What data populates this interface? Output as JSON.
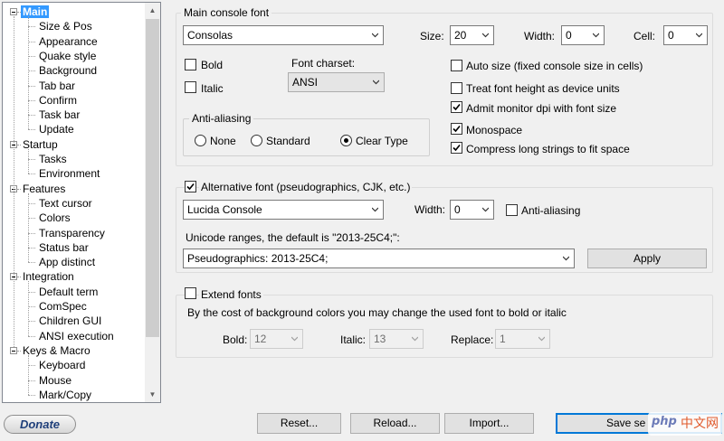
{
  "tree": {
    "items": [
      {
        "label": "Main",
        "level": 0,
        "expanded": true,
        "selected": true
      },
      {
        "label": "Size & Pos",
        "level": 1
      },
      {
        "label": "Appearance",
        "level": 1
      },
      {
        "label": "Quake style",
        "level": 1
      },
      {
        "label": "Background",
        "level": 1
      },
      {
        "label": "Tab bar",
        "level": 1
      },
      {
        "label": "Confirm",
        "level": 1
      },
      {
        "label": "Task bar",
        "level": 1
      },
      {
        "label": "Update",
        "level": 1
      },
      {
        "label": "Startup",
        "level": 0,
        "expanded": true
      },
      {
        "label": "Tasks",
        "level": 1
      },
      {
        "label": "Environment",
        "level": 1
      },
      {
        "label": "Features",
        "level": 0,
        "expanded": true
      },
      {
        "label": "Text cursor",
        "level": 1
      },
      {
        "label": "Colors",
        "level": 1
      },
      {
        "label": "Transparency",
        "level": 1
      },
      {
        "label": "Status bar",
        "level": 1
      },
      {
        "label": "App distinct",
        "level": 1
      },
      {
        "label": "Integration",
        "level": 0,
        "expanded": true
      },
      {
        "label": "Default term",
        "level": 1
      },
      {
        "label": "ComSpec",
        "level": 1
      },
      {
        "label": "Children GUI",
        "level": 1
      },
      {
        "label": "ANSI execution",
        "level": 1
      },
      {
        "label": "Keys & Macro",
        "level": 0,
        "expanded": true
      },
      {
        "label": "Keyboard",
        "level": 1
      },
      {
        "label": "Mouse",
        "level": 1
      },
      {
        "label": "Mark/Copy",
        "level": 1
      }
    ]
  },
  "main_font": {
    "title": "Main console font",
    "font_name": "Consolas",
    "size_label": "Size:",
    "size_value": "20",
    "width_label": "Width:",
    "width_value": "0",
    "cell_label": "Cell:",
    "cell_value": "0",
    "bold_label": "Bold",
    "bold_checked": false,
    "italic_label": "Italic",
    "italic_checked": false,
    "charset_label": "Font charset:",
    "charset_value": "ANSI",
    "antialias_title": "Anti-aliasing",
    "aa_none": "None",
    "aa_standard": "Standard",
    "aa_cleartype": "Clear Type",
    "aa_selected": "cleartype",
    "autosize_label": "Auto size (fixed console size in cells)",
    "autosize_checked": false,
    "treat_height_label": "Treat font height as device units",
    "treat_height_checked": false,
    "admit_dpi_label": "Admit monitor dpi with font size",
    "admit_dpi_checked": true,
    "monospace_label": "Monospace",
    "monospace_checked": true,
    "compress_label": "Compress long strings to fit space",
    "compress_checked": true
  },
  "alt_font": {
    "checkbox_label": "Alternative font (pseudographics, CJK, etc.)",
    "checked": true,
    "font_name": "Lucida Console",
    "width_label": "Width:",
    "width_value": "0",
    "antialias_label": "Anti-aliasing",
    "antialias_checked": false,
    "ranges_label": "Unicode ranges, the default is \"2013-25C4;\":",
    "ranges_value": "Pseudographics: 2013-25C4;",
    "apply_label": "Apply"
  },
  "extend_fonts": {
    "checkbox_label": "Extend fonts",
    "checked": false,
    "description": "By the cost of background colors you may change the used font to bold or italic",
    "bold_label": "Bold:",
    "bold_value": "12",
    "italic_label": "Italic:",
    "italic_value": "13",
    "replace_label": "Replace:",
    "replace_value": "1"
  },
  "footer": {
    "donate_label": "Donate",
    "reset_label": "Reset...",
    "reload_label": "Reload...",
    "import_label": "Import...",
    "save_label": "Save se"
  },
  "watermark": {
    "brand": "php",
    "text": "中文网"
  },
  "colors": {
    "selection": "#3399ff",
    "primary_border": "#0078d7",
    "donate_text": "#1f3f7a"
  }
}
